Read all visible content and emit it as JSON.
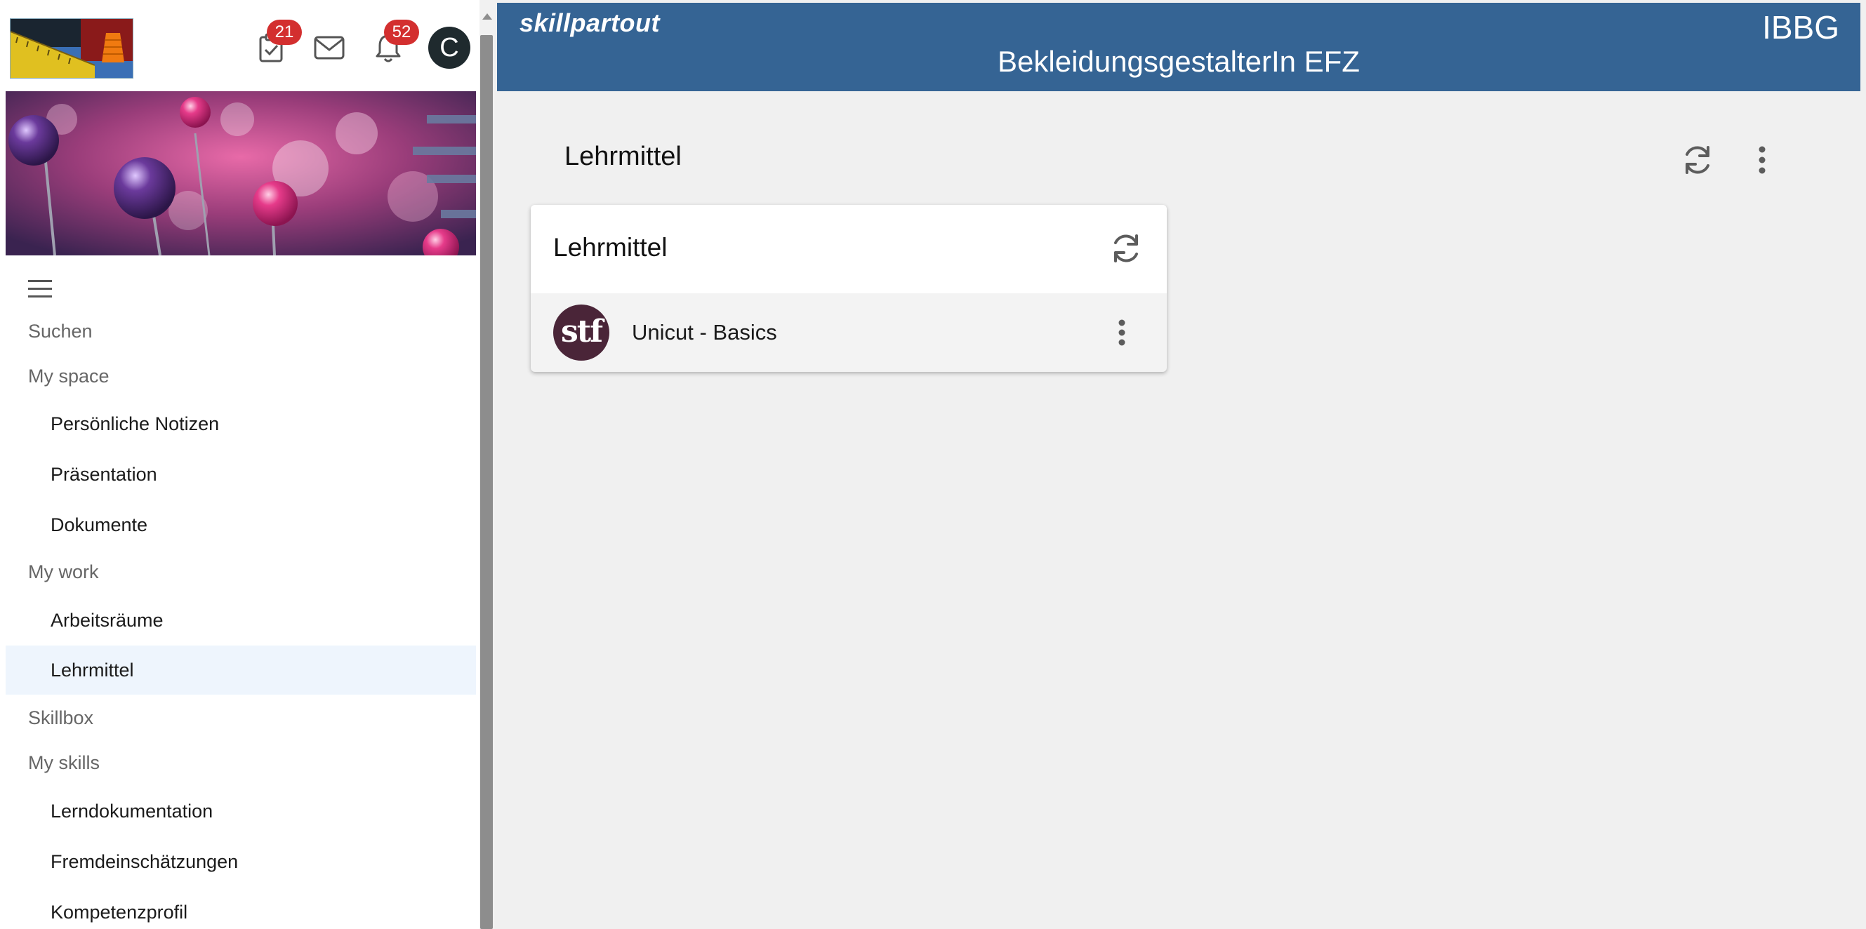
{
  "topbar": {
    "tasks_badge": "21",
    "notifications_badge": "52",
    "avatar_initial": "C",
    "icons": [
      "logo",
      "tasks-clipboard-icon",
      "mail-icon",
      "bell-icon",
      "avatar"
    ]
  },
  "sidebar": {
    "search_label": "Suchen",
    "sections": [
      {
        "label": "My space",
        "items": [
          "Persönliche Notizen",
          "Präsentation",
          "Dokumente"
        ]
      },
      {
        "label": "My work",
        "items": [
          "Arbeitsräume",
          "Lehrmittel"
        ]
      },
      {
        "label": "Skillbox",
        "items": []
      },
      {
        "label": "My skills",
        "items": [
          "Lerndokumentation",
          "Fremdeinschätzungen",
          "Kompetenzprofil"
        ]
      }
    ],
    "active_item": "Lehrmittel"
  },
  "header": {
    "brand": "skillpartout",
    "org": "IBBG",
    "title": "BekleidungsgestalterIn EFZ"
  },
  "main": {
    "page_title": "Lehrmittel",
    "card": {
      "title": "Lehrmittel",
      "items": [
        {
          "logo_text": "stf",
          "label": "Unicut - Basics"
        }
      ]
    }
  },
  "colors": {
    "header_bg": "#356494",
    "badge": "#d32f2f",
    "active_nav_bg": "#eef5fd",
    "main_bg": "#f0f0f0",
    "avatar_bg": "#1f2a2e",
    "item_logo_bg": "#4a2538"
  }
}
